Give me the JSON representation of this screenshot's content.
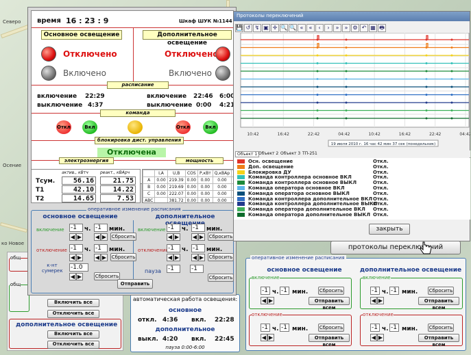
{
  "map": {
    "labels": [
      "Северо",
      "Осение",
      "ко Новое"
    ]
  },
  "main": {
    "time_label": "время",
    "time_value": "16 : 23 : 9",
    "cabinet": "Шкаф ШУК №1144",
    "main_light_header": "Основное освещение",
    "extra_light_header": "Дополнительное освещение",
    "off_label": "Отключено",
    "on_label": "Включено",
    "schedule_header": "расписание",
    "sched": {
      "on_label": "включение",
      "off_label": "выключение",
      "main_on": "22:29",
      "main_off": "4:37",
      "extra_on": "22:46",
      "extra_off": "0:00",
      "total1": "6:00",
      "total2": "4:21"
    },
    "command_header": "команда",
    "cmd_off": "Откл",
    "cmd_on": "Вкл",
    "block_header": "блокировка дист. управления",
    "block_status": "Отключена",
    "energy_header": "электроэнергия",
    "power_header": "мощность",
    "energy_cols": [
      "актив., кВтч",
      "реакт., кВАрч"
    ],
    "energy_rows": [
      {
        "label": "Tсум.",
        "active": "56.16",
        "reactive": "21.75"
      },
      {
        "label": "T1",
        "active": "42.10",
        "reactive": "14.22"
      },
      {
        "label": "T2",
        "active": "14.65",
        "reactive": "7.53"
      }
    ],
    "power_cols": [
      "",
      "I,A",
      "U,B",
      "COS",
      "P,кВт",
      "Q,кВАр",
      "S,кВА"
    ],
    "power_rows": [
      [
        "A",
        "0.00",
        "219.39",
        "0.00",
        "0.00",
        "0.00",
        "0.00"
      ],
      [
        "B",
        "0.00",
        "219.69",
        "0.00",
        "0.00",
        "0.00",
        "0.00"
      ],
      [
        "C",
        "0.00",
        "222.07",
        "0.00",
        "0.00",
        "0.00",
        "0.00"
      ],
      [
        "ABC",
        "",
        "381.72",
        "0.00",
        "0.00",
        "0.00",
        "0.00"
      ]
    ],
    "op_change_legend": "оперативное изменение расписания",
    "op_main": "основное освещение",
    "op_extra": "дополнительное освещение",
    "inc": "включение",
    "exc": "отключение",
    "h": "ч.",
    "min": "мин.",
    "val": "-1",
    "reset": "Сбросить",
    "sunset": "к-нт сумерек",
    "sunset_val": "-1.0",
    "pause": "пауза",
    "send": "Отправить"
  },
  "left_group": {
    "legend1": "общ",
    "legend2": "общ",
    "all_on": "Включить все",
    "all_off": "Отключить все",
    "extra_title": "дополнительное освещение"
  },
  "auto": {
    "title": "автоматическая работа освещения:",
    "main": "основное",
    "extra": "дополнительное",
    "off": "откл.",
    "on": "вкл.",
    "off2": "выкл.",
    "main_off": "4:36",
    "main_on": "22:28",
    "extra_off": "4:20",
    "extra_on": "22:45",
    "pause": "пауза 0:00-6:00"
  },
  "protocol": {
    "title": "Протоколы переключений",
    "toolbar": [
      "💾",
      "↺",
      "↯",
      "▣",
      "✛",
      "🔍",
      "🔍",
      "«",
      "«",
      "‹",
      "›",
      "»",
      "»",
      "⚙",
      "↶",
      "▦",
      "🖶"
    ],
    "x_ticks": [
      "10:42",
      "16:42",
      "22:42",
      "04:42",
      "10:42",
      "16:42",
      "22:42",
      "04:42"
    ],
    "date_caption": "19 июля 2010 г. 16 час 42 мин 37 сек (понедельник)",
    "tabs": [
      "Объект 1",
      "Объект 2",
      "Объект 3",
      "ТП-251"
    ],
    "legend": [
      {
        "name": "Осн. освещение",
        "val": "Откл.",
        "color": "#e0332a"
      },
      {
        "name": "Доп. освещение",
        "val": "Откл.",
        "color": "#ef7d1a"
      },
      {
        "name": "Блокировка ДУ",
        "val": "Откл.",
        "color": "#f4d21a"
      },
      {
        "name": "Команда контроллера основное ВКЛ",
        "val": "Откл.",
        "color": "#33c0b8"
      },
      {
        "name": "Команда контроллера основное ВЫКЛ",
        "val": "Откл.",
        "color": "#1c8a3a"
      },
      {
        "name": "Команда оператора основное ВКЛ",
        "val": "Откл.",
        "color": "#5fb7ea"
      },
      {
        "name": "Команда оператора основное ВЫКЛ",
        "val": "Откл.",
        "color": "#0a4f7a"
      },
      {
        "name": "Команда контроллера дополнительное ВКЛ",
        "val": "Откл.",
        "color": "#2f6fc4"
      },
      {
        "name": "Команда контроллера дополнительное ВЫКЛ",
        "val": "Откл.",
        "color": "#223a8c"
      },
      {
        "name": "Команда оператора дополнительное ВКЛ",
        "val": "Откл.",
        "color": "#3db05a"
      },
      {
        "name": "Команда оператора дополнительное ВЫКЛ",
        "val": "Откл.",
        "color": "#0d6b2b"
      }
    ],
    "close": "закрыть"
  },
  "protocols_btn": "протоколы переключений",
  "right": {
    "legend": "оперативное изменение расписания",
    "main": "основное освещение",
    "extra": "дополнительное освещение",
    "inc": "включение",
    "exc": "отключение",
    "val": "-1",
    "h": "ч.",
    "min": "мин.",
    "reset": "Сбросить",
    "send_all": "Отправить всем"
  }
}
